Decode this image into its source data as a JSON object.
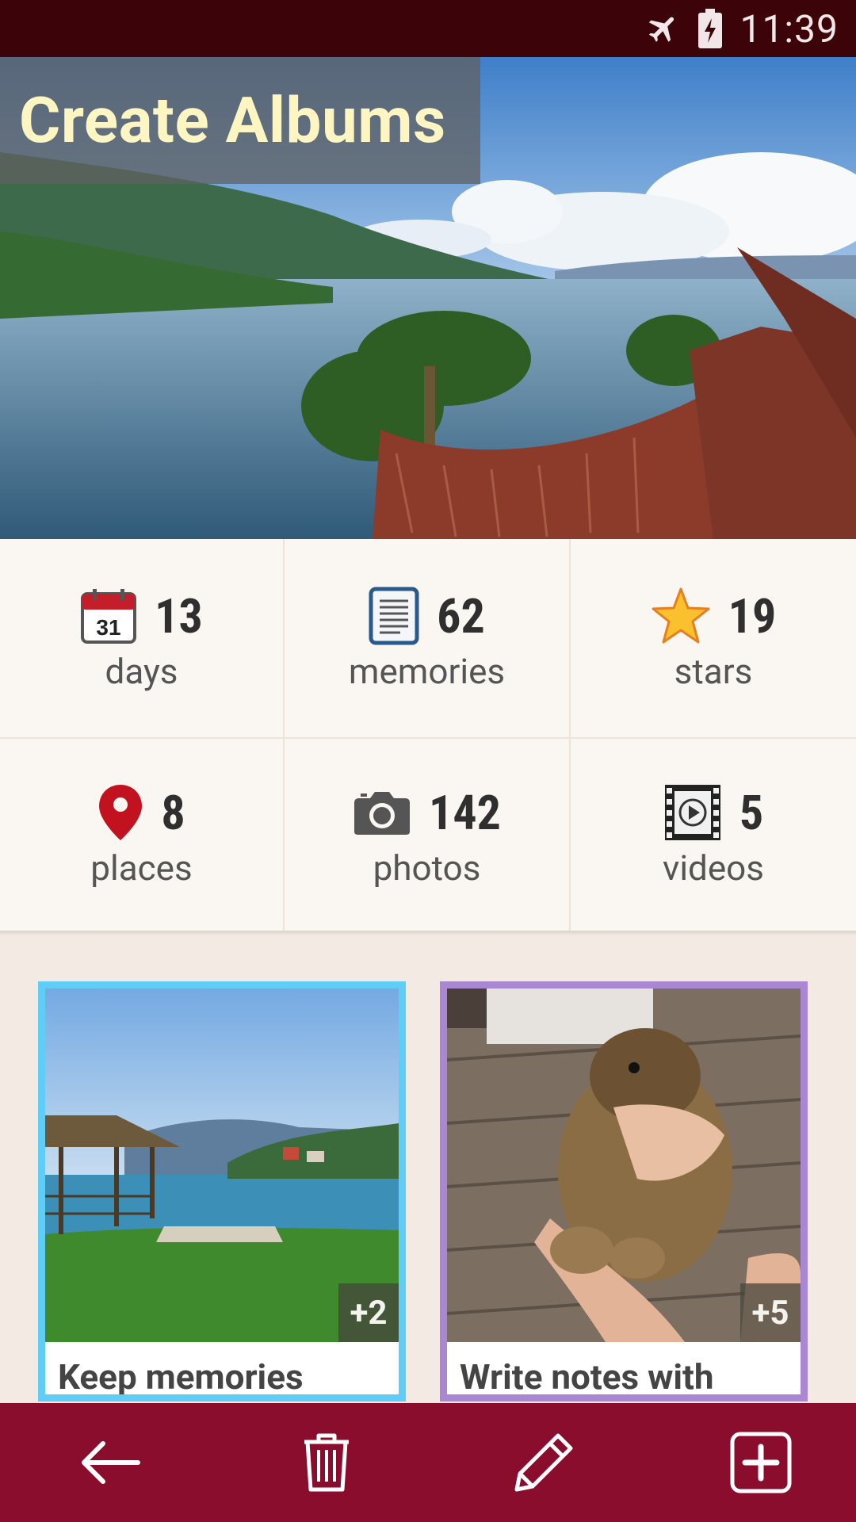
{
  "status_bar": {
    "time": "11:39",
    "icons": [
      "airplane-icon",
      "battery-charging-icon"
    ],
    "background": "#3c0309"
  },
  "hero": {
    "title": "Create Albums",
    "title_color": "#fdf6c2"
  },
  "stats": [
    {
      "icon": "calendar-icon",
      "icon_text": "31",
      "value": "13",
      "label": "days"
    },
    {
      "icon": "notes-icon",
      "value": "62",
      "label": "memories"
    },
    {
      "icon": "star-icon",
      "value": "19",
      "label": "stars"
    },
    {
      "icon": "map-pin-icon",
      "value": "8",
      "label": "places"
    },
    {
      "icon": "camera-icon",
      "value": "142",
      "label": "photos"
    },
    {
      "icon": "film-play-icon",
      "value": "5",
      "label": "videos"
    }
  ],
  "cards": [
    {
      "caption": "Keep memories",
      "badge": "+2",
      "border_color": "#5fcdf5"
    },
    {
      "caption": "Write notes with",
      "badge": "+5",
      "border_color": "#a987d3"
    }
  ],
  "bottom_bar": {
    "background": "#8b0d2d",
    "actions": [
      "back-arrow-icon",
      "trash-icon",
      "pencil-icon",
      "add-box-icon"
    ]
  }
}
